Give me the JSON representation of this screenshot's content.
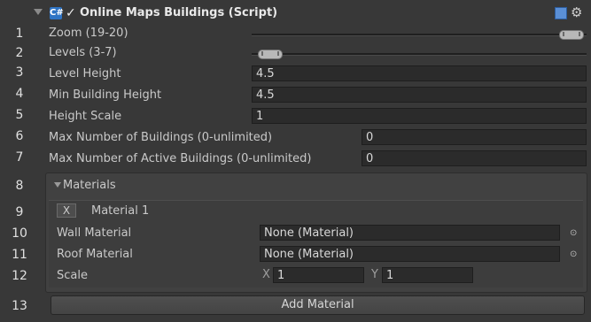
{
  "header": {
    "title": "Online Maps Buildings (Script)",
    "enabled": "✓"
  },
  "line_numbers": [
    "1",
    "2",
    "3",
    "4",
    "5",
    "6",
    "7",
    "8",
    "9",
    "10",
    "11",
    "12",
    "13"
  ],
  "fields": {
    "zoom_label": "Zoom (19-20)",
    "levels_label": "Levels (3-7)",
    "level_height_label": "Level Height",
    "level_height_value": "4.5",
    "min_building_height_label": "Min Building Height",
    "min_building_height_value": "4.5",
    "height_scale_label": "Height Scale",
    "height_scale_value": "1",
    "max_buildings_label": "Max Number of Buildings (0-unlimited)",
    "max_buildings_value": "0",
    "max_active_label": "Max Number of Active Buildings (0-unlimited)",
    "max_active_value": "0"
  },
  "materials": {
    "section_label": "Materials",
    "remove_label": "X",
    "item_title": "Material 1",
    "wall_label": "Wall Material",
    "wall_value": "None (Material)",
    "roof_label": "Roof Material",
    "roof_value": "None (Material)",
    "scale_label": "Scale",
    "scale_x_label": "X",
    "scale_x_value": "1",
    "scale_y_label": "Y",
    "scale_y_value": "1",
    "picker_glyph": "⊙",
    "add_button_label": "Add Material"
  },
  "icons": {
    "script": "script-icon",
    "help": "help-icon",
    "settings": "gear-icon"
  }
}
